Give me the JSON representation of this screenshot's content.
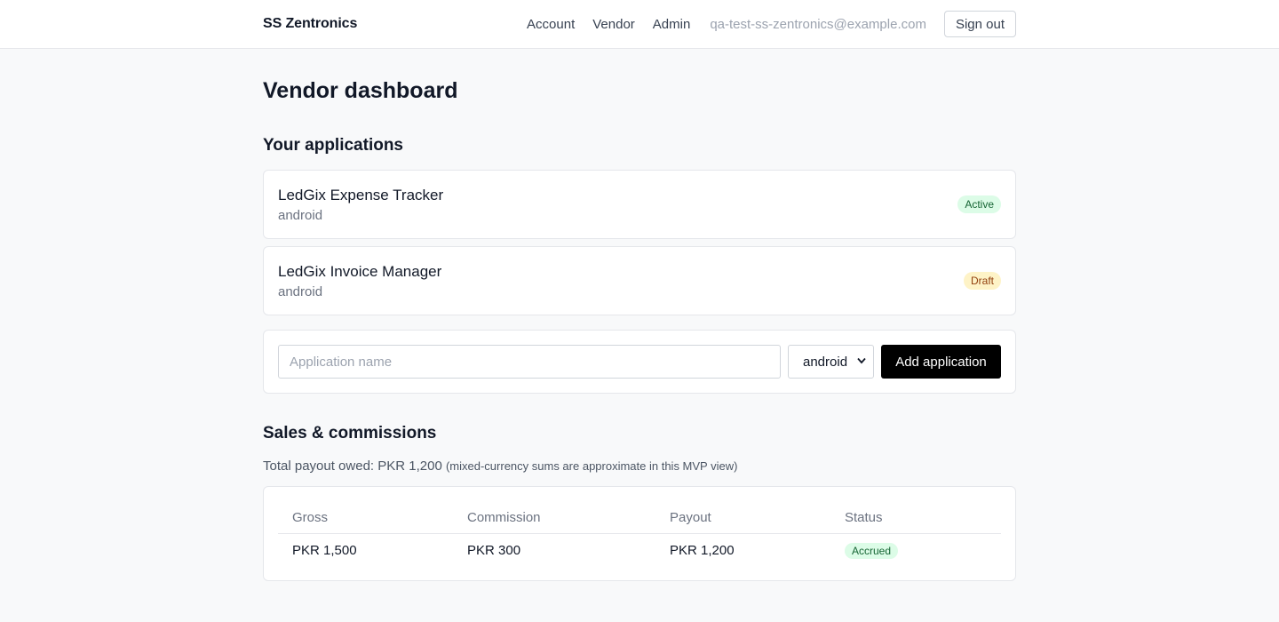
{
  "header": {
    "brand": "SS Zentronics",
    "nav": [
      "Account",
      "Vendor",
      "Admin"
    ],
    "email": "qa-test-ss-zentronics@example.com",
    "signout_label": "Sign out"
  },
  "page": {
    "title": "Vendor dashboard"
  },
  "applications": {
    "section_title": "Your applications",
    "items": [
      {
        "name": "LedGix Expense Tracker",
        "platform": "android",
        "status": "Active"
      },
      {
        "name": "LedGix Invoice Manager",
        "platform": "android",
        "status": "Draft"
      }
    ],
    "form": {
      "name_placeholder": "Application name",
      "platform_selected": "android",
      "add_label": "Add application"
    }
  },
  "sales": {
    "section_title": "Sales & commissions",
    "payout_text": "Total payout owed: PKR 1,200",
    "payout_note": "(mixed-currency sums are approximate in this MVP view)",
    "columns": [
      "Gross",
      "Commission",
      "Payout",
      "Status"
    ],
    "rows": [
      {
        "gross": "PKR 1,500",
        "commission": "PKR 300",
        "payout": "PKR 1,200",
        "status": "Accrued"
      }
    ]
  },
  "colors": {
    "active_badge_bg": "#dcfce7",
    "draft_badge_bg": "#fef3c7",
    "primary_button": "#000000"
  }
}
